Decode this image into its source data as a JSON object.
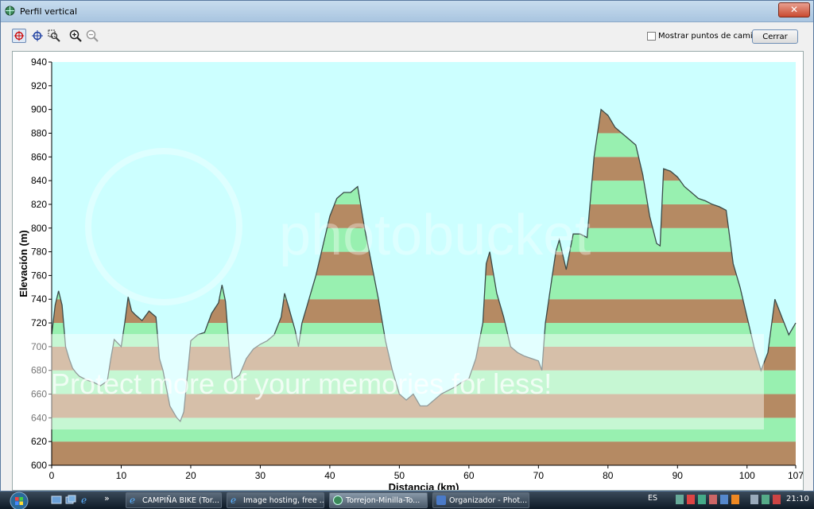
{
  "window": {
    "title": "Perfil vertical",
    "close_label": "✕"
  },
  "toolbar": {
    "tools": [
      "select-tool-icon",
      "pan-tool-icon",
      "zoom-window-icon",
      "zoom-in-icon",
      "zoom-out-icon"
    ],
    "show_waypoints_label": "Mostrar puntos de camino",
    "show_waypoints_checked": false,
    "close_button_label": "Cerrar"
  },
  "chart_data": {
    "type": "area",
    "xlabel": "Distancia   (km)",
    "ylabel": "Elevación (m)",
    "xlim": [
      0,
      107
    ],
    "ylim": [
      600,
      940
    ],
    "x_ticks": [
      0,
      10,
      20,
      30,
      40,
      50,
      60,
      70,
      80,
      90,
      100,
      107
    ],
    "y_ticks": [
      600,
      620,
      640,
      660,
      680,
      700,
      720,
      740,
      760,
      780,
      800,
      820,
      840,
      860,
      880,
      900,
      920,
      940
    ],
    "band_colors": [
      "#b58a63",
      "#98f0b0"
    ],
    "background_color": "#ccffff",
    "line_color": "#3a4a48",
    "x": [
      0,
      0.5,
      1,
      1.5,
      2,
      2.5,
      3,
      3.5,
      4,
      5,
      6,
      7,
      8,
      8.5,
      9,
      10,
      10.5,
      11,
      11.5,
      12,
      13,
      14,
      15,
      15.5,
      16,
      17,
      18,
      18.5,
      19,
      20,
      21,
      22,
      23,
      24,
      24.5,
      25,
      25.5,
      26,
      27,
      28,
      29,
      30,
      31,
      32,
      33,
      33.5,
      34,
      35,
      35.5,
      36,
      37,
      38,
      39,
      40,
      41,
      42,
      43,
      44,
      45,
      46,
      47,
      48,
      49,
      50,
      51,
      52,
      53,
      54,
      55,
      56,
      57,
      58,
      59,
      60,
      61,
      62,
      62.5,
      63,
      64,
      65,
      66,
      67,
      68,
      69,
      70,
      70.5,
      71,
      72,
      72.5,
      73,
      74,
      75,
      76,
      77,
      78,
      79,
      80,
      81,
      82,
      83,
      84,
      85,
      86,
      87,
      87.5,
      88,
      89,
      90,
      91,
      92,
      93,
      94,
      95,
      96,
      97,
      98,
      99,
      100,
      101,
      102,
      103,
      104,
      105,
      106,
      107
    ],
    "y": [
      710,
      735,
      747,
      735,
      700,
      690,
      682,
      678,
      675,
      672,
      670,
      667,
      671,
      690,
      706,
      700,
      720,
      742,
      730,
      727,
      722,
      730,
      725,
      690,
      680,
      650,
      640,
      637,
      645,
      705,
      710,
      712,
      728,
      737,
      752,
      738,
      700,
      672,
      676,
      690,
      698,
      702,
      705,
      710,
      725,
      745,
      735,
      714,
      700,
      720,
      740,
      760,
      785,
      810,
      825,
      830,
      830,
      835,
      800,
      770,
      740,
      705,
      680,
      660,
      655,
      660,
      650,
      650,
      655,
      660,
      663,
      666,
      670,
      673,
      690,
      720,
      770,
      780,
      745,
      725,
      700,
      695,
      692,
      690,
      688,
      680,
      720,
      760,
      780,
      790,
      765,
      795,
      795,
      792,
      860,
      900,
      895,
      885,
      880,
      875,
      870,
      845,
      810,
      787,
      785,
      850,
      848,
      843,
      835,
      830,
      825,
      823,
      820,
      818,
      815,
      770,
      750,
      725,
      700,
      680,
      695,
      740,
      725,
      710,
      720
    ],
    "values_note": ""
  },
  "watermark": {
    "brand": "photobucket",
    "tagline": "Protect more of your memories for less!"
  },
  "taskbar": {
    "tasks": [
      {
        "label": "CAMPIÑA BIKE (Tor...",
        "icon": "ie-icon",
        "active": false
      },
      {
        "label": "Image hosting, free ...",
        "icon": "ie-icon",
        "active": false
      },
      {
        "label": "Torrejon-Minilla-To...",
        "icon": "globe-icon",
        "active": true
      },
      {
        "label": "Organizador - Phot...",
        "icon": "camera-icon",
        "active": false
      }
    ],
    "chevron_label": "»",
    "language": "ES",
    "clock": "21:10"
  }
}
